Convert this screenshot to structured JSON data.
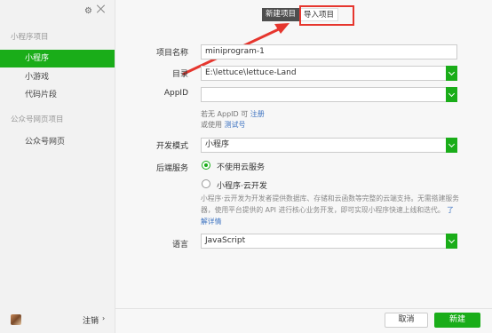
{
  "sidebar": {
    "mini_section": "小程序项目",
    "items": [
      {
        "label": "小程序"
      },
      {
        "label": "小游戏"
      },
      {
        "label": "代码片段"
      }
    ],
    "official_section": "公众号网页项目",
    "official_items": [
      {
        "label": "公众号网页"
      }
    ],
    "logout": "注销",
    "logout_arrow": "›",
    "gear_icon": "⚙"
  },
  "tabs": {
    "new_project": "新建项目",
    "import_project": "导入项目"
  },
  "form": {
    "project_name_label": "项目名称",
    "project_name_value": "miniprogram-1",
    "directory_label": "目录",
    "directory_value": "E:\\lettuce\\lettuce-Land",
    "appid_label": "AppID",
    "appid_value": "",
    "appid_hint_prefix": "若无 AppID 可",
    "appid_hint_link": "注册",
    "appid_hint2_prefix": "或使用",
    "appid_hint2_link": "测试号",
    "dev_mode_label": "开发模式",
    "dev_mode_value": "小程序",
    "backend_label": "后端服务",
    "backend_option1": "不使用云服务",
    "backend_option2": "小程序·云开发",
    "backend_desc": "小程序·云开发为开发者提供数据库、存储和云函数等完整的云端支持。无需搭建服务器，使用平台提供的 API 进行核心业务开发，即可实现小程序快速上线和迭代。",
    "backend_desc_link": "了解详情",
    "language_label": "语言",
    "language_value": "JavaScript"
  },
  "buttons": {
    "cancel": "取消",
    "create": "新建"
  },
  "colors": {
    "accent": "#1aad19",
    "annotation": "#e6362e",
    "link": "#3d73c1"
  }
}
